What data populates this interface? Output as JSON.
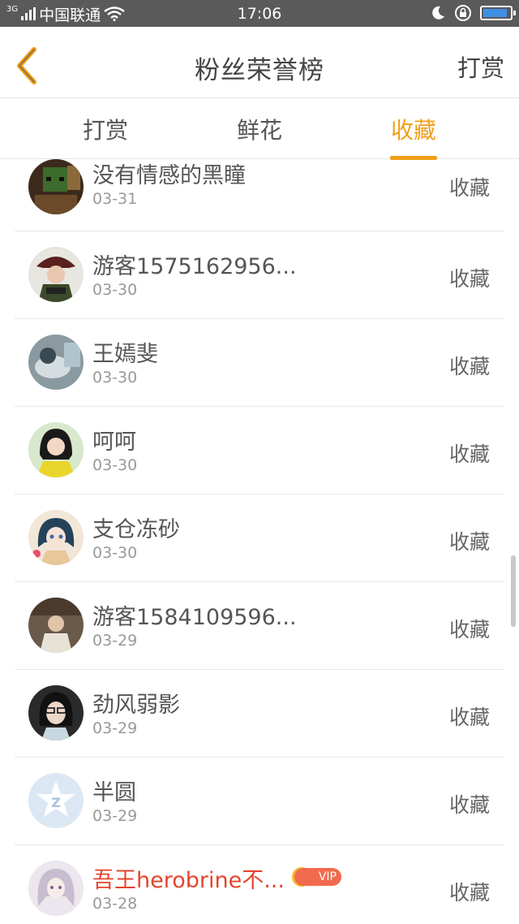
{
  "status_bar": {
    "network": "3G",
    "carrier": "中国联通",
    "time": "17:06",
    "battery_level": 0.9
  },
  "header": {
    "title": "粉丝荣誉榜",
    "right_action": "打赏"
  },
  "tabs": [
    {
      "label": "打赏",
      "active": false
    },
    {
      "label": "鲜花",
      "active": false
    },
    {
      "label": "收藏",
      "active": true
    }
  ],
  "colors": {
    "accent": "#f0a01a",
    "vip_name": "#e4452c",
    "vip_badge": "#f26a4e"
  },
  "list": [
    {
      "name": "没有情感的黑瞳",
      "date": "03-31",
      "action": "收藏",
      "vip": false
    },
    {
      "name": "游客1575162956...",
      "date": "03-30",
      "action": "收藏",
      "vip": false
    },
    {
      "name": "王嫣斐",
      "date": "03-30",
      "action": "收藏",
      "vip": false
    },
    {
      "name": "呵呵",
      "date": "03-30",
      "action": "收藏",
      "vip": false
    },
    {
      "name": "支仓冻砂",
      "date": "03-30",
      "action": "收藏",
      "vip": false
    },
    {
      "name": "游客1584109596...",
      "date": "03-29",
      "action": "收藏",
      "vip": false
    },
    {
      "name": "劲风弱影",
      "date": "03-29",
      "action": "收藏",
      "vip": false
    },
    {
      "name": "半圆",
      "date": "03-29",
      "action": "收藏",
      "vip": false
    },
    {
      "name": "吾王herobrine不...",
      "date": "03-28",
      "action": "收藏",
      "vip": true,
      "badge": "VIP"
    }
  ]
}
